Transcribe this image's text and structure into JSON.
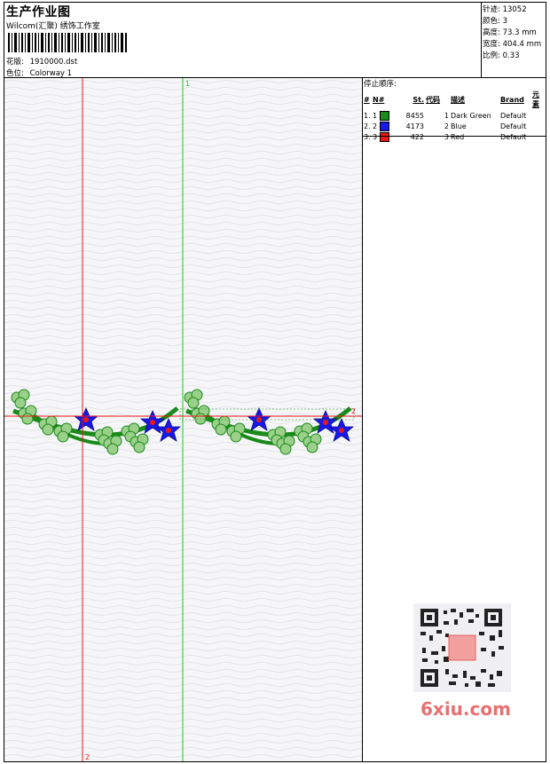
{
  "header": {
    "title": "生产作业图",
    "subtitle": "Wilcom(汇聚) 绣饰工作室",
    "design_label": "花版:",
    "design_value": "1910000.dst",
    "color_label": "色位:",
    "color_value": "Colorway 1"
  },
  "stats": [
    {
      "label": "针迹:",
      "value": "13052"
    },
    {
      "label": "颜色:",
      "value": "3"
    },
    {
      "label": "高度:",
      "value": "73.3 mm"
    },
    {
      "label": "宽度:",
      "value": "404.4 mm"
    },
    {
      "label": "比例:",
      "value": "0.33"
    }
  ],
  "stop_sequence": {
    "heading": "停止顺序:",
    "columns": [
      "#",
      "N#",
      "St.",
      "代码",
      "描述",
      "Brand",
      "元素"
    ],
    "rows": [
      {
        "idx": "1.",
        "n": "1",
        "color": "#1a8a1a",
        "st": "8455",
        "code": "1",
        "desc": "Dark Green",
        "brand": "Default"
      },
      {
        "idx": "2.",
        "n": "2",
        "color": "#1818e8",
        "st": "4173",
        "code": "2",
        "desc": "Blue",
        "brand": "Default"
      },
      {
        "idx": "3.",
        "n": "3",
        "color": "#e81818",
        "st": "422",
        "code": "3",
        "desc": "Red",
        "brand": "Default"
      }
    ]
  },
  "guides": {
    "red_label_bottom": "2",
    "green_label_top": "1",
    "horizontal_label": "2"
  },
  "watermark": {
    "text": "6xiu.com"
  }
}
